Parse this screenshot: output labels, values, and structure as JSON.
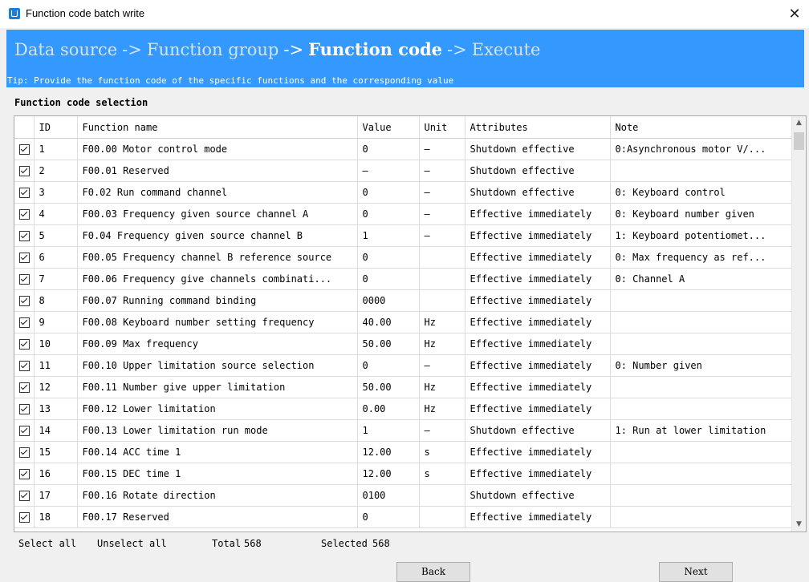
{
  "window": {
    "title": "Function code batch write",
    "close_glyph": "✕"
  },
  "banner": {
    "steps": [
      "Data source",
      "Function group",
      "Function code",
      "Execute"
    ],
    "arrow": "->",
    "active_step": "Function code",
    "tip": "Tip: Provide the function code of the specific functions and the corresponding value",
    "bg_color": "#3399ff"
  },
  "section_title": "Function code selection",
  "table": {
    "headers": [
      "",
      "ID",
      "Function name",
      "Value",
      "Unit",
      "Attributes",
      "Note"
    ],
    "rows": [
      {
        "checked": true,
        "id": "1",
        "name": "F00.00 Motor control mode",
        "value": "0",
        "unit": "–",
        "attr": "Shutdown effective",
        "note": "0:Asynchronous motor V/..."
      },
      {
        "checked": true,
        "id": "2",
        "name": "F00.01 Reserved",
        "value": "–",
        "unit": "–",
        "attr": "Shutdown effective",
        "note": ""
      },
      {
        "checked": true,
        "id": "3",
        "name": "F0.02 Run command channel",
        "value": "0",
        "unit": "–",
        "attr": "Shutdown effective",
        "note": "0: Keyboard control"
      },
      {
        "checked": true,
        "id": "4",
        "name": "F00.03 Frequency given source channel A",
        "value": "0",
        "unit": "–",
        "attr": "Effective immediately",
        "note": "0: Keyboard number given"
      },
      {
        "checked": true,
        "id": "5",
        "name": "F0.04 Frequency given source channel B",
        "value": "1",
        "unit": "–",
        "attr": "Effective immediately",
        "note": "1: Keyboard potentiomet..."
      },
      {
        "checked": true,
        "id": "6",
        "name": "F00.05 Frequency channel B reference source",
        "value": "0",
        "unit": "",
        "attr": "Effective immediately",
        "note": "0: Max frequency as ref..."
      },
      {
        "checked": true,
        "id": "7",
        "name": "F00.06 Frequency give channels combinati...",
        "value": "0",
        "unit": "",
        "attr": "Effective immediately",
        "note": "0: Channel A"
      },
      {
        "checked": true,
        "id": "8",
        "name": "F00.07 Running command binding",
        "value": "0000",
        "unit": "",
        "attr": "Effective immediately",
        "note": ""
      },
      {
        "checked": true,
        "id": "9",
        "name": "F00.08 Keyboard number setting frequency",
        "value": "40.00",
        "unit": "Hz",
        "attr": "Effective immediately",
        "note": ""
      },
      {
        "checked": true,
        "id": "10",
        "name": "F00.09 Max frequency",
        "value": "50.00",
        "unit": "Hz",
        "attr": "Effective immediately",
        "note": ""
      },
      {
        "checked": true,
        "id": "11",
        "name": "F00.10 Upper limitation source selection",
        "value": "0",
        "unit": "–",
        "attr": "Effective immediately",
        "note": "0: Number given"
      },
      {
        "checked": true,
        "id": "12",
        "name": "F00.11 Number give upper limitation",
        "value": "50.00",
        "unit": "Hz",
        "attr": "Effective immediately",
        "note": ""
      },
      {
        "checked": true,
        "id": "13",
        "name": "F00.12 Lower limitation",
        "value": "0.00",
        "unit": "Hz",
        "attr": "Effective immediately",
        "note": ""
      },
      {
        "checked": true,
        "id": "14",
        "name": "F00.13 Lower limitation run mode",
        "value": "1",
        "unit": "–",
        "attr": "Shutdown effective",
        "note": "1: Run at lower limitation"
      },
      {
        "checked": true,
        "id": "15",
        "name": "F00.14 ACC time 1",
        "value": "12.00",
        "unit": "s",
        "attr": "Effective immediately",
        "note": ""
      },
      {
        "checked": true,
        "id": "16",
        "name": "F00.15 DEC time 1",
        "value": "12.00",
        "unit": "s",
        "attr": "Effective immediately",
        "note": ""
      },
      {
        "checked": true,
        "id": "17",
        "name": "F00.16 Rotate direction",
        "value": "0100",
        "unit": "",
        "attr": "Shutdown effective",
        "note": ""
      },
      {
        "checked": true,
        "id": "18",
        "name": "F00.17 Reserved",
        "value": "0",
        "unit": "",
        "attr": "Effective immediately",
        "note": ""
      }
    ]
  },
  "footer": {
    "select_all": "Select all",
    "unselect_all": "Unselect all",
    "total_label": "Total",
    "total_value": "568",
    "selected_label": "Selected",
    "selected_value": "568"
  },
  "buttons": {
    "back": "Back",
    "next": "Next"
  },
  "icons": {
    "scroll_up": "chevron-up-icon",
    "scroll_down": "chevron-down-icon",
    "checkbox": "checkmark-icon"
  }
}
